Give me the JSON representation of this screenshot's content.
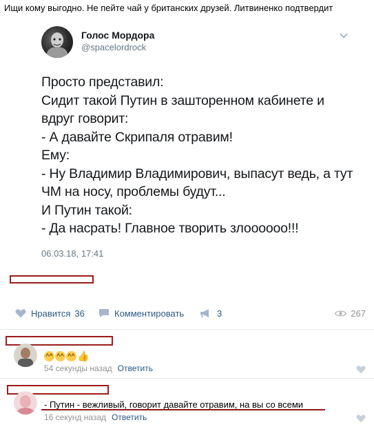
{
  "post": {
    "caption": "Ищи кому выгодно. Не пейте чай у британских друзей. Литвиненко подтвердит"
  },
  "tweet": {
    "author_name": "Голос Мордора",
    "author_handle": "@spacelordrock",
    "lines": [
      "Просто представил:",
      "Сидит такой Путин в зашторенном кабинете и",
      "вдруг говорит:",
      "- А давайте Скрипаля отравим!",
      "Ему:",
      "- Ну Владимир Владимирович, выпасут ведь, а тут",
      "ЧМ на носу, проблемы будут...",
      "И Путин такой:",
      "- Да насрать! Главное творить злоооооо!!!"
    ],
    "date": "06.03.18, 17:41"
  },
  "actions": {
    "like_label": "Нравится",
    "like_count": "36",
    "comment_label": "Комментировать",
    "share_count": "3",
    "views_count": "267"
  },
  "comments": [
    {
      "text": "",
      "time": "54 секунды назад",
      "reply_label": "Ответить"
    },
    {
      "text": "- Путин - вежливый, говорит давайте отравим, на вы со всеми",
      "time": "16 секунд назад",
      "reply_label": "Ответить"
    }
  ],
  "colors": {
    "link": "#2a5885",
    "muted": "#939393",
    "redaction": "#9c1b1b"
  }
}
